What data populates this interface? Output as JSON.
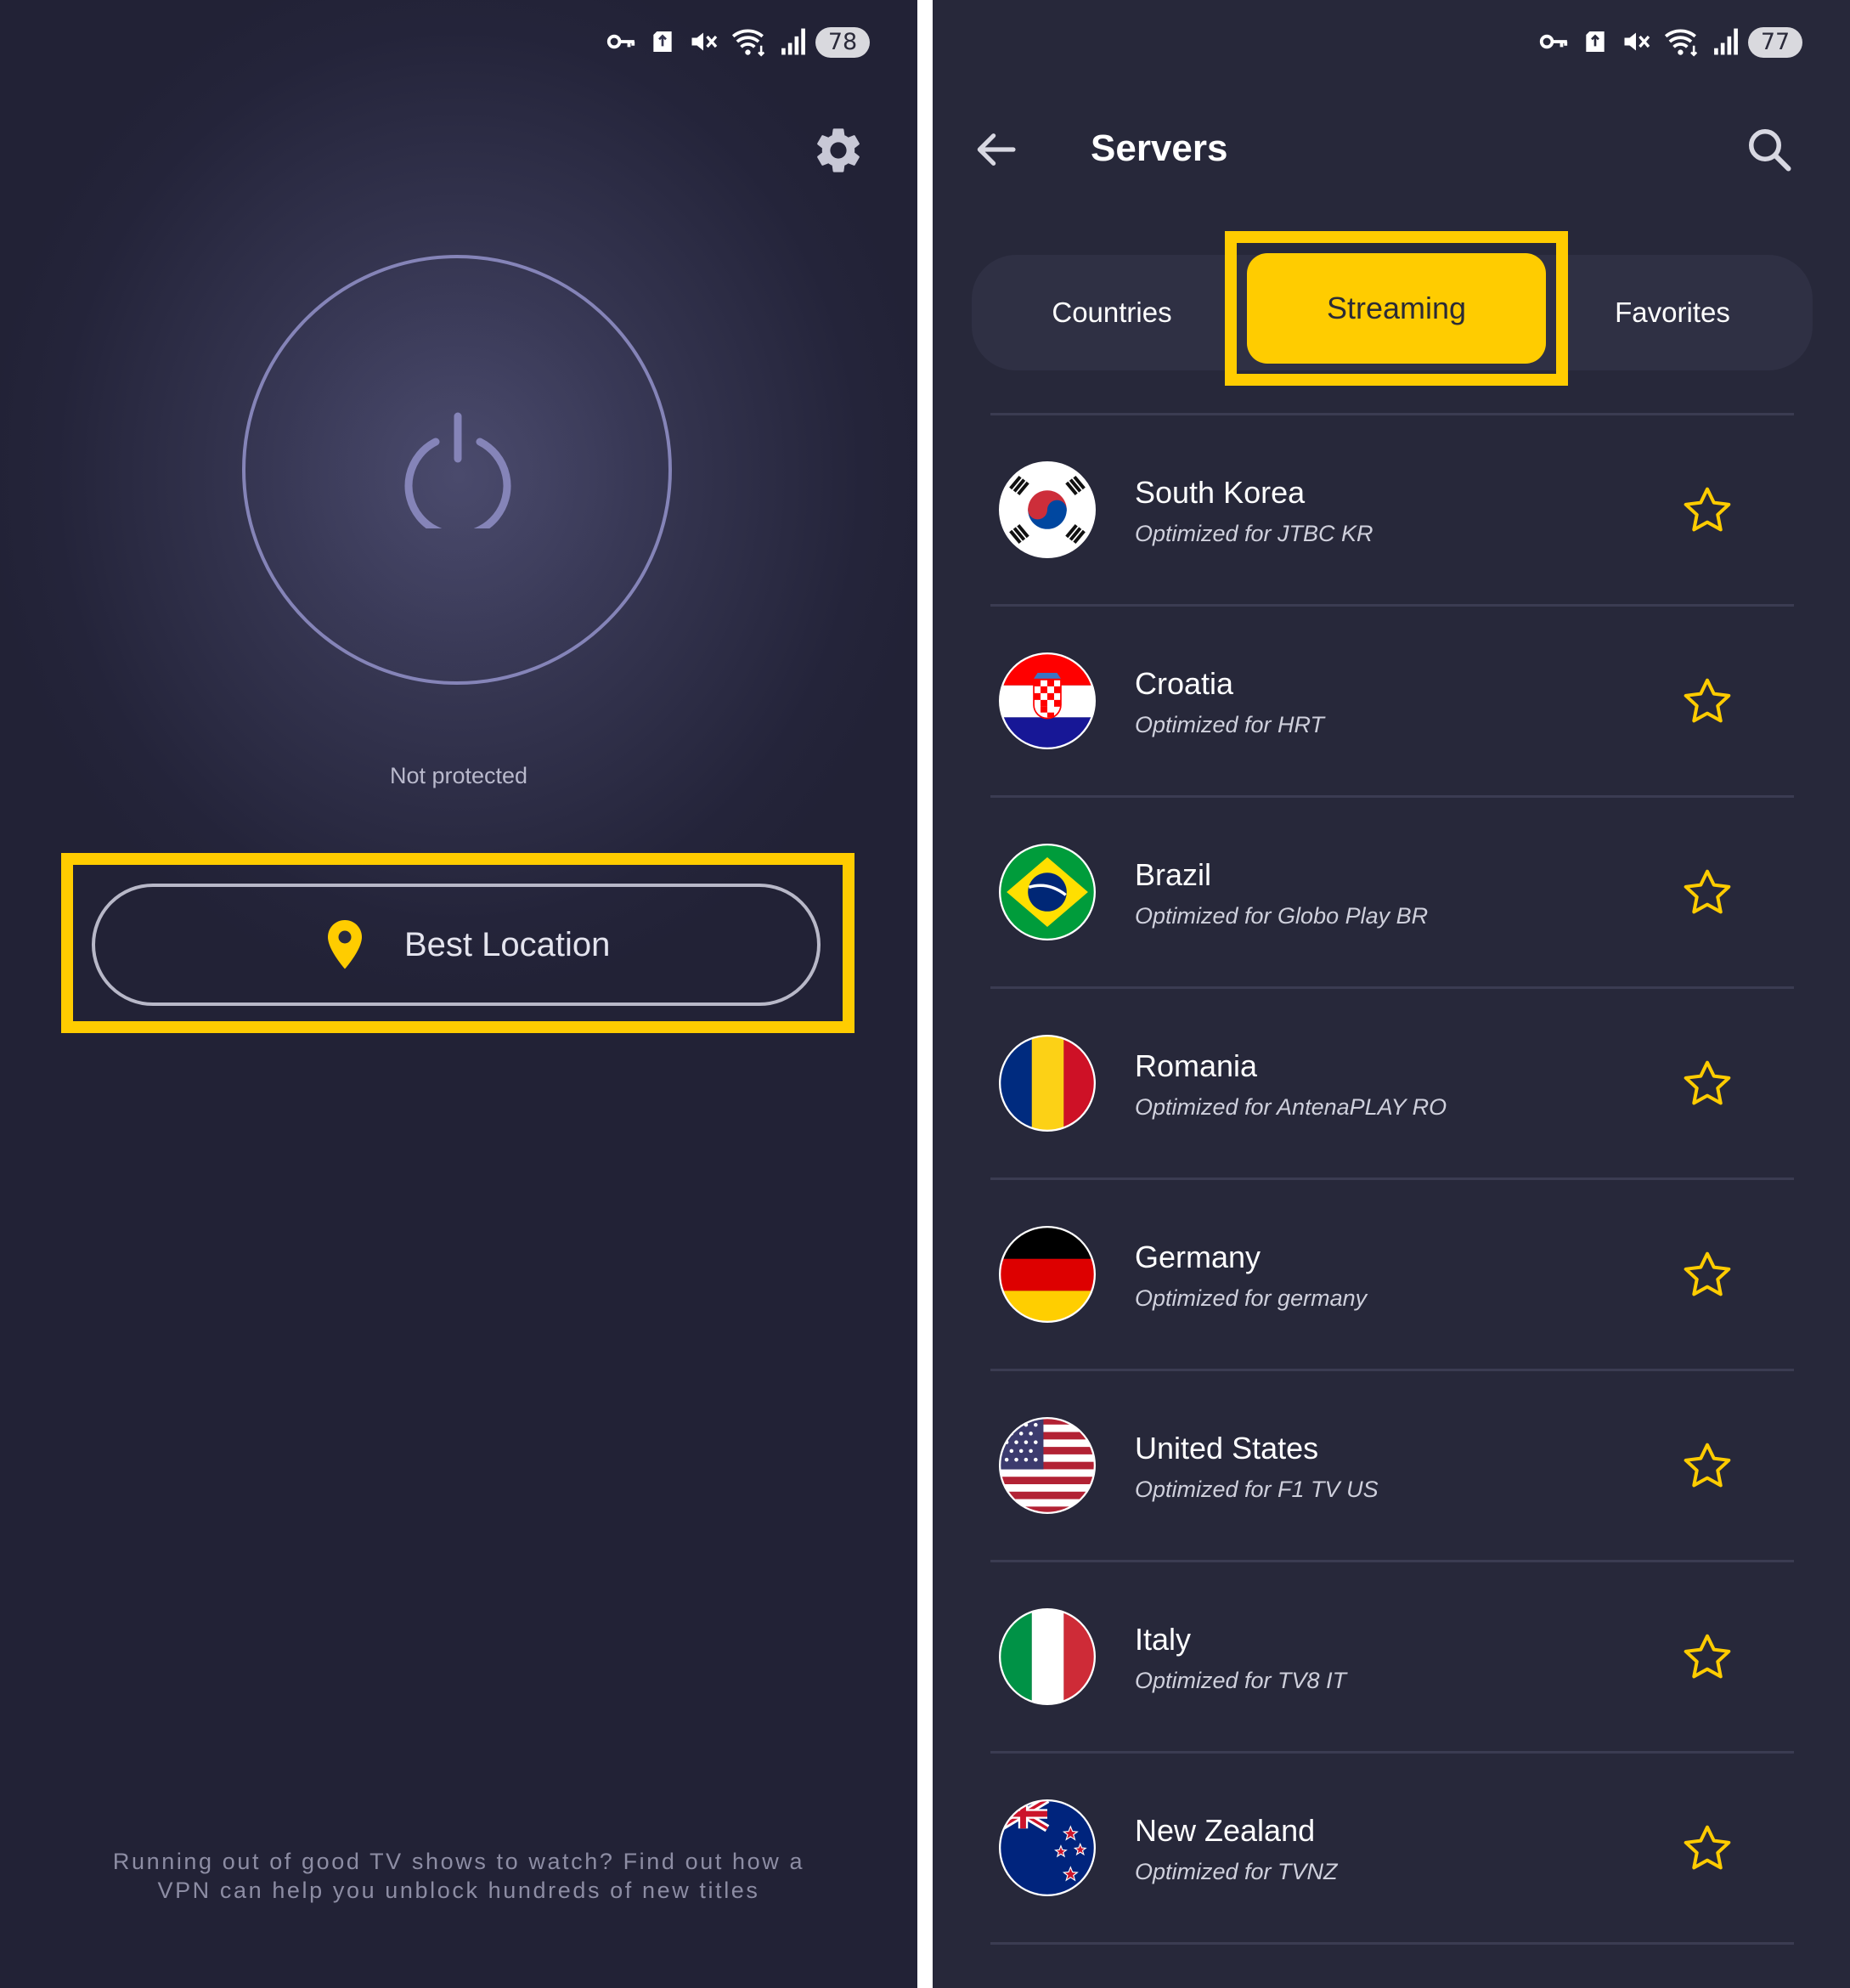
{
  "left_screen": {
    "status_bar": {
      "battery": "78"
    },
    "power": {
      "status_text": "Not protected"
    },
    "location_button": {
      "label": "Best Location"
    },
    "promo": {
      "line1": "Running out of good TV shows to watch? Find out how a",
      "line2": "VPN can help you unblock hundreds of new titles"
    }
  },
  "right_screen": {
    "status_bar": {
      "battery": "77"
    },
    "header": {
      "title": "Servers"
    },
    "tabs": [
      {
        "label": "Countries",
        "active": false
      },
      {
        "label": "Streaming",
        "active": true
      },
      {
        "label": "Favorites",
        "active": false
      }
    ],
    "servers": [
      {
        "country": "South Korea",
        "subtitle": "Optimized for JTBC KR"
      },
      {
        "country": "Croatia",
        "subtitle": "Optimized for HRT"
      },
      {
        "country": "Brazil",
        "subtitle": "Optimized for Globo Play BR"
      },
      {
        "country": "Romania",
        "subtitle": "Optimized for AntenaPLAY RO"
      },
      {
        "country": "Germany",
        "subtitle": "Optimized for germany"
      },
      {
        "country": "United States",
        "subtitle": "Optimized for F1 TV US"
      },
      {
        "country": "Italy",
        "subtitle": "Optimized for TV8 IT"
      },
      {
        "country": "New Zealand",
        "subtitle": "Optimized for TVNZ"
      }
    ]
  },
  "colors": {
    "accent": "#ffcc00",
    "left_background": "#2a2a40",
    "right_background": "#27283a",
    "ring": "#8584b8"
  },
  "icons": [
    "key-icon",
    "sd-card-icon",
    "mute-icon",
    "wifi-icon",
    "signal-icon",
    "gear-icon",
    "power-icon",
    "location-pin-icon",
    "arrow-back-icon",
    "search-icon",
    "star-icon"
  ]
}
